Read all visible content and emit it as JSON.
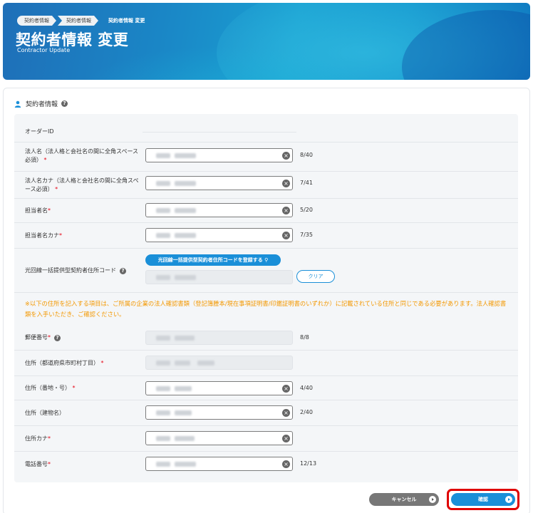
{
  "breadcrumb": [
    "契約者情報",
    "契約者情報",
    "契約者情報 変更"
  ],
  "header": {
    "title": "契約者情報 変更",
    "subtitle": "Contractor Update"
  },
  "section": {
    "title": "契約者情報",
    "icon": "person-icon"
  },
  "fields": {
    "order_id": {
      "label": "オーダーID"
    },
    "corp_name": {
      "label": "法人名（法人格と会社名の間に全角スペース必須）",
      "count": "8/40"
    },
    "corp_name_kana": {
      "label": "法人名カナ（法人格と会社名の間に全角スペース必須）",
      "count": "7/41"
    },
    "person": {
      "label": "担当者名",
      "count": "5/20"
    },
    "person_kana": {
      "label": "担当者名カナ",
      "count": "7/35"
    },
    "fiber_code": {
      "label": "光回線一括提供型契約者住所コード",
      "register_button": "光回線一括提供型契約者住所コードを登録する",
      "clear_button": "クリア"
    },
    "notice": "※以下の住所を記入する項目は、ご所属の企業の法人確認書類（登記簿謄本/現在事項証明書/印鑑証明書のいずれか）に記載されている住所と同じである必要があります。法人確認書類を入手いただき、ご確認ください。",
    "zip": {
      "label": "郵便番号",
      "count": "8/8"
    },
    "address_pref": {
      "label": "住所（都道府県市町村丁目）"
    },
    "address_num": {
      "label": "住所（番地・号）",
      "count": "4/40"
    },
    "address_bldg": {
      "label": "住所（建物名）",
      "count": "2/40"
    },
    "address_kana": {
      "label": "住所カナ"
    },
    "phone": {
      "label": "電話番号",
      "count": "12/13"
    }
  },
  "buttons": {
    "cancel": "キャンセル",
    "confirm": "確認"
  },
  "colors": {
    "accent": "#1a8fd8",
    "notice": "#f39800",
    "required": "#e60012",
    "highlight": "#e00000"
  }
}
